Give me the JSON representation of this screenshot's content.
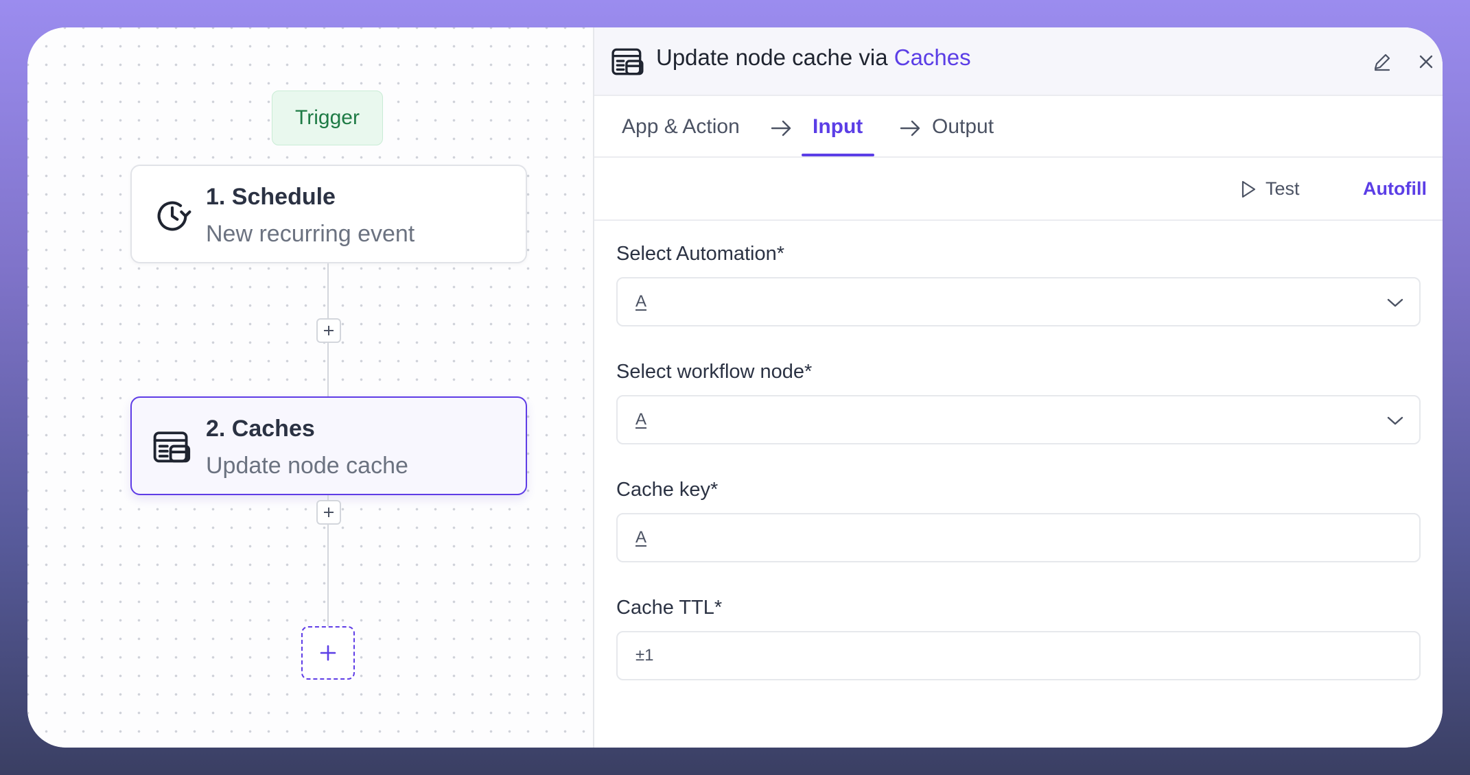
{
  "canvas": {
    "trigger_label": "Trigger",
    "nodes": [
      {
        "title": "1. Schedule",
        "subtitle": "New recurring event",
        "icon": "clock-icon"
      },
      {
        "title": "2. Caches",
        "subtitle": "Update node cache",
        "icon": "cache-icon"
      }
    ]
  },
  "panel": {
    "title_prefix": "Update node cache via",
    "title_app": "Caches",
    "tabs": [
      "App & Action",
      "Input",
      "Output"
    ],
    "active_tab": "Input",
    "test_label": "Test",
    "autofill_label": "Autofill",
    "fields": [
      {
        "label": "Select Automation*",
        "glyph": "A",
        "type": "select"
      },
      {
        "label": "Select workflow node*",
        "glyph": "A",
        "type": "select"
      },
      {
        "label": "Cache key*",
        "glyph": "A",
        "type": "text"
      },
      {
        "label": "Cache TTL*",
        "glyph": "±1",
        "type": "number"
      }
    ]
  },
  "colors": {
    "accent": "#5b3ee6",
    "trigger_bg": "#e9f8ee",
    "trigger_text": "#1e7b45"
  }
}
